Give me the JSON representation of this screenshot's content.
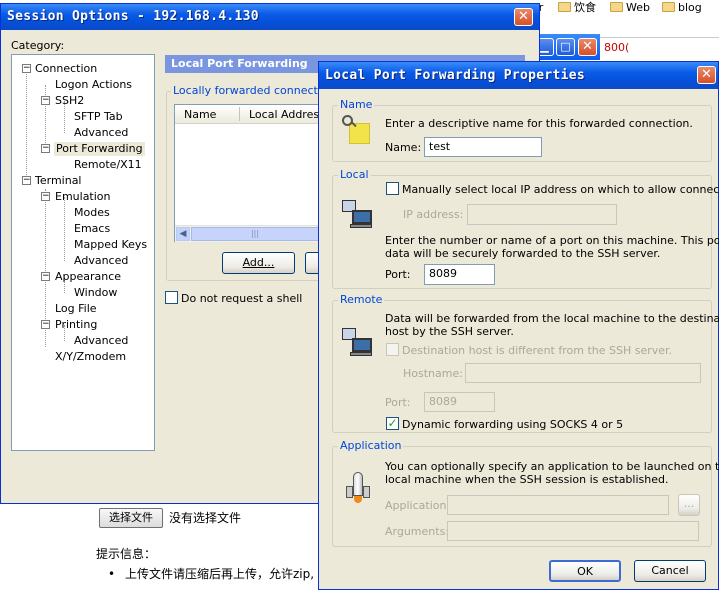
{
  "browser_bg": {
    "bookmarks": [
      {
        "label": "or"
      },
      {
        "label": "饮食"
      },
      {
        "label": "Web"
      },
      {
        "label": "blog"
      }
    ],
    "upload_button": "选择文件",
    "upload_status": "没有选择文件",
    "hint_title": "提示信息：",
    "hint_line": "上传文件请压缩后再上传，允许zip, r",
    "red_text": "800("
  },
  "session": {
    "title": "Session Options - 192.168.4.130",
    "category_label": "Category:",
    "tree": [
      "Connection",
      "Logon Actions",
      "SSH2",
      "SFTP Tab",
      "Advanced",
      "Port Forwarding",
      "Remote/X11",
      "Terminal",
      "Emulation",
      "Modes",
      "Emacs",
      "Mapped Keys",
      "Advanced",
      "Appearance",
      "Window",
      "Log File",
      "Printing",
      "Advanced",
      "X/Y/Zmodem"
    ],
    "panel_title": "Local Port Forwarding",
    "list_group_label": "Locally forwarded connections",
    "columns": [
      "Name",
      "Local Address"
    ],
    "add_button": "Add...",
    "no_shell_label": "Do not request a shell"
  },
  "props": {
    "title": "Local Port Forwarding Properties",
    "name_group": "Name",
    "name_desc": "Enter a descriptive name for this forwarded connection.",
    "name_label": "Name:",
    "name_value": "test",
    "local_group": "Local",
    "manual_ip_label": "Manually select local IP address on which to allow connections.",
    "ip_label": "IP address:",
    "port_desc_1": "Enter the number or name of a port on this machine.  This port's",
    "port_desc_2": "data will be securely forwarded to the SSH server.",
    "port_label": "Port:",
    "port_value": "8089",
    "remote_group": "Remote",
    "remote_desc_1": "Data will be forwarded from the local machine to the destination",
    "remote_desc_2": "host by the SSH server.",
    "dest_label": "Destination host is different from the SSH server.",
    "hostname_label": "Hostname:",
    "remote_port_label": "Port:",
    "remote_port_value": "8089",
    "dynamic_label": "Dynamic forwarding using SOCKS 4 or 5",
    "dynamic_checked": true,
    "app_group": "Application",
    "app_desc_1": "You can optionally specify an application to be launched on the",
    "app_desc_2": "local machine when the SSH session is established.",
    "application_label": "Application:",
    "browse_label": "...",
    "arguments_label": "Arguments:",
    "ok_button": "OK",
    "cancel_button": "Cancel"
  }
}
